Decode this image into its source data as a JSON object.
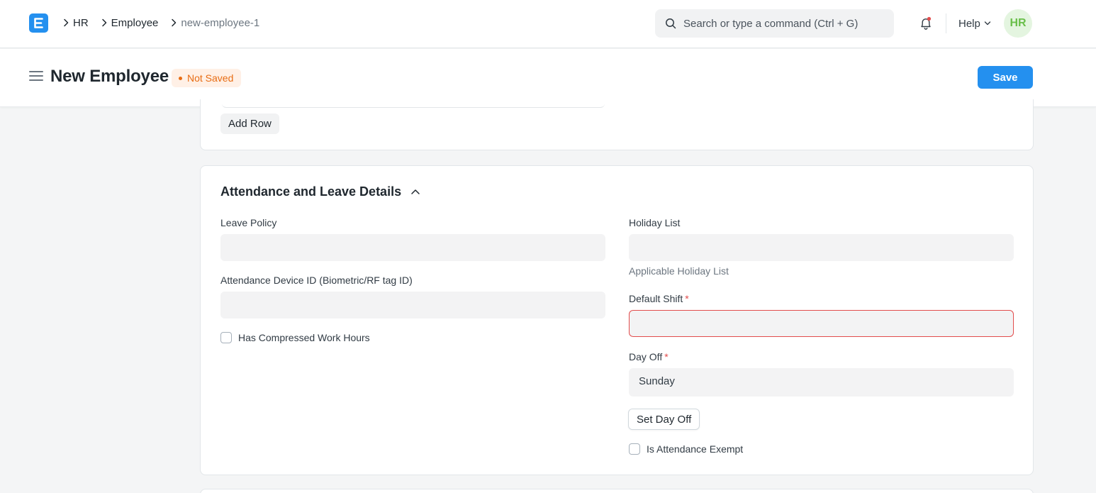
{
  "navbar": {
    "breadcrumbs": [
      "HR",
      "Employee",
      "new-employee-1"
    ],
    "search_placeholder": "Search or type a command (Ctrl + G)",
    "help_label": "Help",
    "avatar_initials": "HR"
  },
  "page": {
    "title": "New Employee",
    "status": "Not Saved",
    "save_label": "Save"
  },
  "previous_section": {
    "add_row_label": "Add Row"
  },
  "attendance_section": {
    "title": "Attendance and Leave Details",
    "leave_policy": {
      "label": "Leave Policy",
      "value": ""
    },
    "attendance_device_id": {
      "label": "Attendance Device ID (Biometric/RF tag ID)",
      "value": ""
    },
    "has_compressed_work_hours": {
      "label": "Has Compressed Work Hours",
      "checked": false
    },
    "holiday_list": {
      "label": "Holiday List",
      "value": "",
      "description": "Applicable Holiday List"
    },
    "default_shift": {
      "label": "Default Shift",
      "required": "*",
      "value": ""
    },
    "day_off": {
      "label": "Day Off",
      "required": "*",
      "value": "Sunday"
    },
    "set_day_off_label": "Set Day Off",
    "is_attendance_exempt": {
      "label": "Is Attendance Exempt",
      "checked": false
    }
  },
  "colors": {
    "primary": "#2490ef",
    "status_orange": "#e86c13",
    "status_bg": "#fff0e6",
    "error_red": "#e24c4c",
    "avatar_bg": "#e4f5e0",
    "avatar_fg": "#6abf4b"
  },
  "icons": [
    "app-logo-icon",
    "chevron-right-icon",
    "search-icon",
    "bell-icon",
    "chevron-down-icon",
    "hamburger-icon",
    "chevron-up-icon"
  ]
}
